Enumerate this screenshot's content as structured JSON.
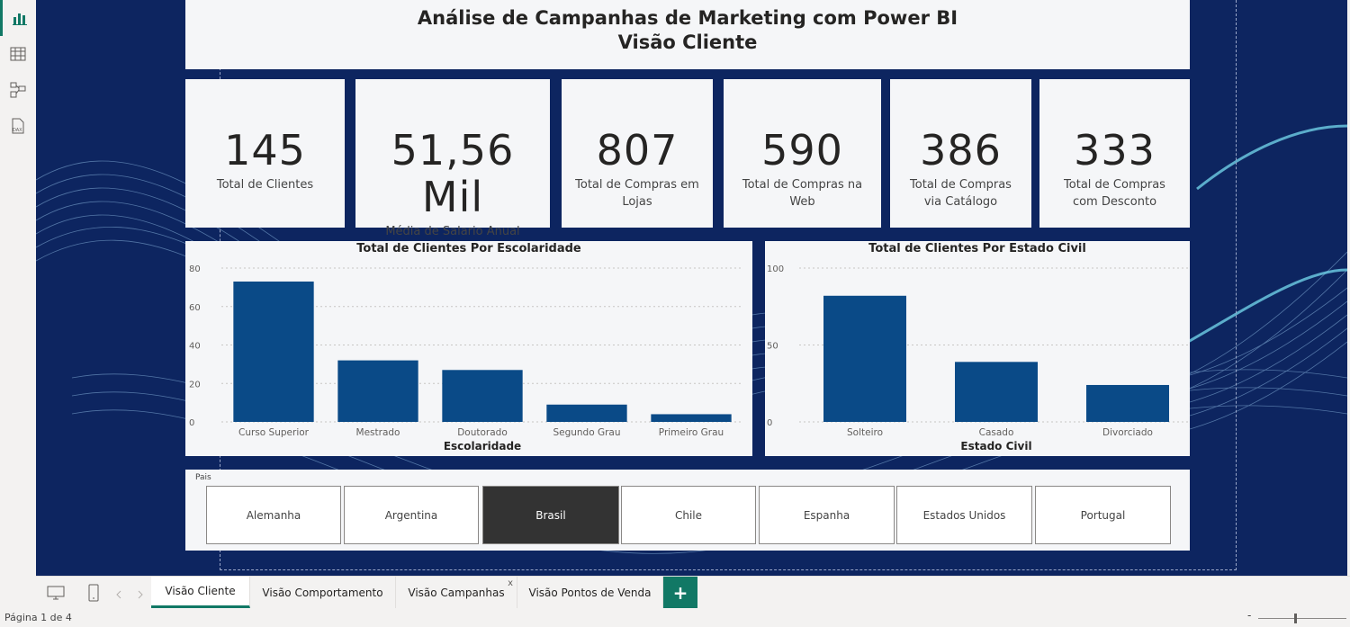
{
  "header": {
    "title_line1": "Análise de Campanhas de Marketing com Power BI",
    "title_line2": "Visão Cliente"
  },
  "kpis": [
    {
      "value": "145",
      "label": "Total de Clientes"
    },
    {
      "value": "51,56 Mil",
      "label": "Média de Salario Anual"
    },
    {
      "value": "807",
      "label": "Total de Compras em Lojas"
    },
    {
      "value": "590",
      "label": "Total de Compras na Web"
    },
    {
      "value": "386",
      "label": "Total de Compras via Catálogo"
    },
    {
      "value": "333",
      "label": "Total de Compras com Desconto"
    }
  ],
  "chart_data": [
    {
      "type": "bar",
      "title": "Total de Clientes Por Escolaridade",
      "xlabel": "Escolaridade",
      "ylabel": "",
      "categories": [
        "Curso Superior",
        "Mestrado",
        "Doutorado",
        "Segundo Grau",
        "Primeiro Grau"
      ],
      "values": [
        73,
        32,
        27,
        9,
        4
      ],
      "yticks": [
        "80",
        "60",
        "40",
        "20",
        "0"
      ],
      "ylim": [
        0,
        80
      ],
      "grid": true,
      "color": "#0a4a87"
    },
    {
      "type": "bar",
      "title": "Total de Clientes Por Estado Civil",
      "xlabel": "Estado Civil",
      "ylabel": "",
      "categories": [
        "Solteiro",
        "Casado",
        "Divorciado"
      ],
      "values": [
        82,
        39,
        24
      ],
      "yticks": [
        "100",
        "50",
        "0"
      ],
      "ylim": [
        0,
        100
      ],
      "grid": true,
      "color": "#0a4a87"
    }
  ],
  "slicer": {
    "title": "Pais",
    "options": [
      "Alemanha",
      "Argentina",
      "Brasil",
      "Chile",
      "Espanha",
      "Estados Unidos",
      "Portugal"
    ],
    "selected": "Brasil"
  },
  "tabs": [
    {
      "label": "Visão Cliente",
      "active": true
    },
    {
      "label": "Visão Comportamento",
      "active": false
    },
    {
      "label": "Visão Campanhas",
      "active": false
    },
    {
      "label": "Visão Pontos de Venda",
      "active": false
    }
  ],
  "tab_close_glyph": "x",
  "add_page_glyph": "+",
  "status": {
    "page_indicator": "Página 1 de 4",
    "zoom_minus": "-"
  },
  "icons": [
    "report-view-icon",
    "table-view-icon",
    "model-view-icon",
    "dax-query-icon",
    "desktop-layout-icon",
    "mobile-layout-icon",
    "prev-page-icon",
    "next-page-icon"
  ],
  "colors": {
    "canvas_bg": "#0d2560",
    "bar": "#0a4a87",
    "accent": "#117865",
    "selected_slicer": "#333333"
  }
}
